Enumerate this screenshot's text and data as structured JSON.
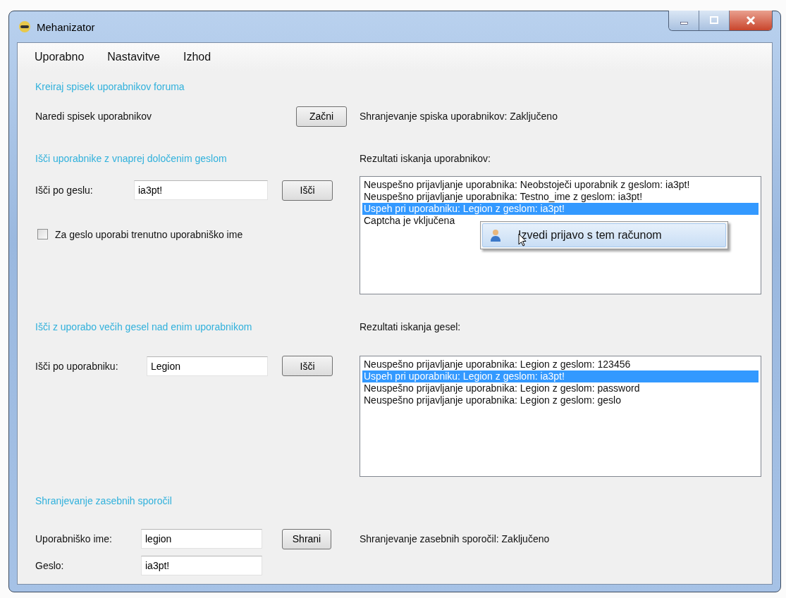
{
  "window": {
    "title": "Mehanizator"
  },
  "menu": [
    {
      "label": "Uporabno"
    },
    {
      "label": "Nastavitve"
    },
    {
      "label": "Izhod"
    }
  ],
  "user_list": {
    "title": "Kreiraj spisek uporabnikov foruma",
    "label": "Naredi spisek uporabnikov",
    "button": "Začni",
    "status": "Shranjevanje spiska uporabnikov: Zaključeno"
  },
  "password_search": {
    "title": "Išči uporabnike z vnaprej določenim geslom",
    "label": "Išči po geslu:",
    "value": "ia3pt!",
    "button": "Išči",
    "checkbox": {
      "label": "Za geslo uporabi trenutno uporabniško ime",
      "checked": false
    },
    "results_label": "Rezultati iskanja uporabnikov:",
    "results": [
      {
        "text": "Neuspešno prijavljanje uporabnika: Neobstoječi uporabnik z geslom: ia3pt!",
        "selected": false
      },
      {
        "text": "Neuspešno prijavljanje uporabnika: Testno_ime z geslom: ia3pt!",
        "selected": false
      },
      {
        "text": "Uspeh pri uporabniku: Legion z geslom: ia3pt!",
        "selected": true
      },
      {
        "text": "Captcha je vključena",
        "selected": false
      }
    ],
    "context_menu": {
      "items": [
        {
          "label": "Izvedi prijavo s tem računom",
          "selected": true
        }
      ]
    }
  },
  "user_search": {
    "title": "Išči z uporabo večih gesel nad enim uporabnikom",
    "label": "Išči po uporabniku:",
    "value": "Legion",
    "button": "Išči",
    "results_label": "Rezultati iskanja gesel:",
    "results": [
      {
        "text": "Neuspešno prijavljanje uporabnika: Legion z geslom: 123456",
        "selected": false
      },
      {
        "text": "Uspeh pri uporabniku: Legion z geslom: ia3pt!",
        "selected": true
      },
      {
        "text": "Neuspešno prijavljanje uporabnika: Legion z geslom: password",
        "selected": false
      },
      {
        "text": "Neuspešno prijavljanje uporabnika: Legion z geslom: geslo",
        "selected": false
      }
    ]
  },
  "messages": {
    "title": "Shranjevanje zasebnih sporočil",
    "username_label": "Uporabniško ime:",
    "username": "legion",
    "password_label": "Geslo:",
    "password": "ia3pt!",
    "button": "Shrani",
    "status": "Shranjevanje zasebnih sporočil: Zaključeno"
  }
}
